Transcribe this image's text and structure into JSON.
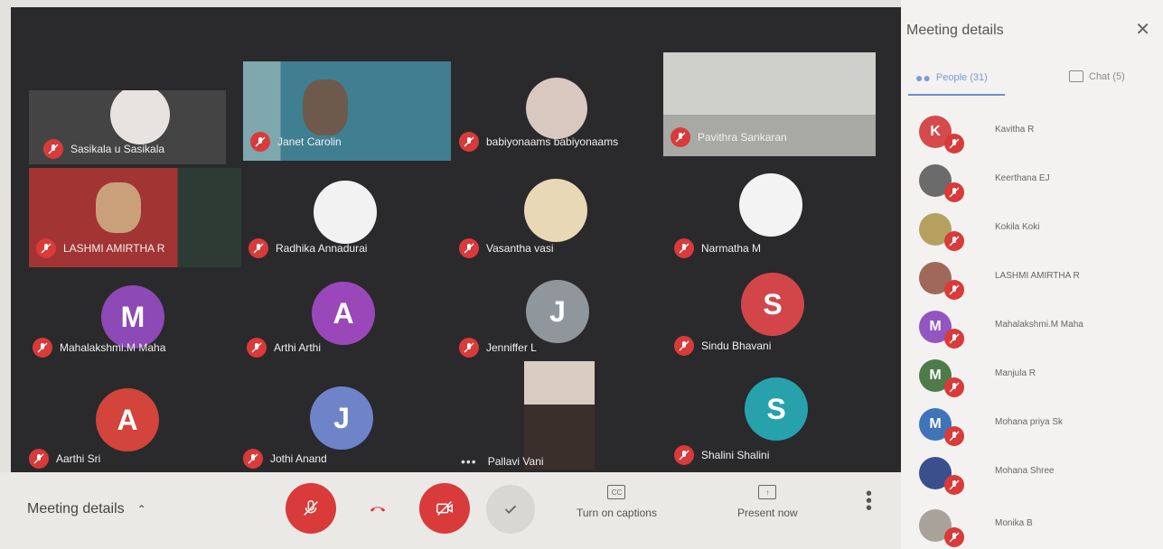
{
  "tiles": [
    {
      "name": "Sasikala u Sasikala",
      "initial": "",
      "color": "#e8e3e0",
      "kind": "photo"
    },
    {
      "name": "Janet Carolin",
      "initial": "",
      "color": "#4d8a9a",
      "kind": "video"
    },
    {
      "name": "babiyonaams babiyonaams",
      "initial": "",
      "color": "#d8c8c0",
      "kind": "photo"
    },
    {
      "name": "Pavithra Sankaran",
      "initial": "",
      "color": "#b9b9b6",
      "kind": "video"
    },
    {
      "name": "LASHMI AMIRTHA R",
      "initial": "",
      "color": "#9b2f2f",
      "kind": "video"
    },
    {
      "name": "Radhika Annadurai",
      "initial": "",
      "color": "#f2f2f2",
      "kind": "photo"
    },
    {
      "name": "Vasantha vasi",
      "initial": "",
      "color": "#e9d8b6",
      "kind": "photo"
    },
    {
      "name": "Narmatha M",
      "initial": "",
      "color": "#f3f3f3",
      "kind": "photo"
    },
    {
      "name": "Mahalakshmi.M Maha",
      "initial": "M",
      "color": "#8d49b5",
      "kind": "letter"
    },
    {
      "name": "Arthi Arthi",
      "initial": "A",
      "color": "#9a48b9",
      "kind": "letter"
    },
    {
      "name": "Jenniffer L",
      "initial": "J",
      "color": "#8f979c",
      "kind": "letter"
    },
    {
      "name": "Sindu Bhavani",
      "initial": "S",
      "color": "#d2464a",
      "kind": "letter"
    },
    {
      "name": "Aarthi Sri",
      "initial": "A",
      "color": "#d2443c",
      "kind": "letter"
    },
    {
      "name": "Jothi Anand",
      "initial": "J",
      "color": "#6f83c9",
      "kind": "letter"
    },
    {
      "name": "Pallavi Vani",
      "initial": "",
      "color": "#c9b7a9",
      "kind": "video"
    },
    {
      "name": "Shalini Shalini",
      "initial": "S",
      "color": "#27a2ad",
      "kind": "letter"
    }
  ],
  "bottom": {
    "meeting_details": "Meeting details",
    "captions": "Turn on captions",
    "present": "Present now"
  },
  "panel": {
    "title": "Meeting details",
    "people_tab": "People (31)",
    "chat_tab": "Chat (5)",
    "people": [
      {
        "name": "Kavitha R",
        "initial": "K",
        "color": "#d54b4b"
      },
      {
        "name": "Keerthana EJ",
        "initial": "",
        "color": "#6b6b6b"
      },
      {
        "name": "Kokila Koki",
        "initial": "",
        "color": "#b6a060"
      },
      {
        "name": "LASHMI AMIRTHA R",
        "initial": "",
        "color": "#a0685a"
      },
      {
        "name": "Mahalakshmi.M Maha",
        "initial": "M",
        "color": "#9356c0"
      },
      {
        "name": "Manjula R",
        "initial": "M",
        "color": "#4f7a4a"
      },
      {
        "name": "Mohana priya Sk",
        "initial": "M",
        "color": "#3f74b8"
      },
      {
        "name": "Mohana Shree",
        "initial": "",
        "color": "#3a4f8c"
      },
      {
        "name": "Monika B",
        "initial": "",
        "color": "#a8a29a"
      }
    ]
  },
  "colors": {
    "mute_red": "#d93a3a",
    "grid_bg": "#2a2a2c",
    "accent_blue": "#6a8fd3"
  }
}
